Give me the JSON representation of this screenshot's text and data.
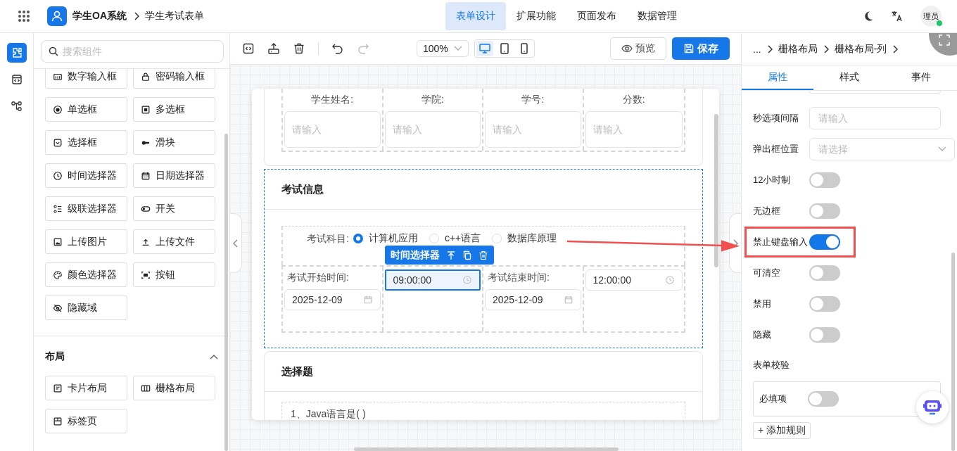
{
  "header": {
    "app_name": "学生OA系统",
    "breadcrumb": "学生考试表单",
    "avatar": "理员",
    "online": true
  },
  "nav_tabs": [
    {
      "label": "表单设计",
      "selected": true
    },
    {
      "label": "扩展功能",
      "selected": false
    },
    {
      "label": "页面发布",
      "selected": false
    },
    {
      "label": "数据管理",
      "selected": false
    }
  ],
  "rail": [
    {
      "kind": "components",
      "selected": true
    },
    {
      "kind": "code",
      "selected": false
    },
    {
      "kind": "tree",
      "selected": false
    }
  ],
  "component_panel": {
    "search": {
      "placeholder": "搜索组件"
    },
    "components": [
      {
        "label": "数字输入框",
        "kind": "number"
      },
      {
        "label": "密码输入框",
        "kind": "lock"
      },
      {
        "label": "单选框",
        "kind": "radio"
      },
      {
        "label": "多选框",
        "kind": "checkbox"
      },
      {
        "label": "选择框",
        "kind": "select"
      },
      {
        "label": "滑块",
        "kind": "slider"
      },
      {
        "label": "时间选择器",
        "kind": "clock"
      },
      {
        "label": "日期选择器",
        "kind": "calendar"
      },
      {
        "label": "级联选择器",
        "kind": "cascade"
      },
      {
        "label": "开关",
        "kind": "switch"
      },
      {
        "label": "上传图片",
        "kind": "image"
      },
      {
        "label": "上传文件",
        "kind": "upload"
      },
      {
        "label": "颜色选择器",
        "kind": "palette"
      },
      {
        "label": "按钮",
        "kind": "button"
      },
      {
        "label": "隐藏域",
        "kind": "hidden"
      }
    ],
    "layout_section": {
      "title": "布局",
      "expanded": true,
      "items": [
        {
          "label": "卡片布局",
          "kind": "card"
        },
        {
          "label": "栅格布局",
          "kind": "grid"
        },
        {
          "label": "标签页",
          "kind": "tabs"
        }
      ]
    }
  },
  "toolbar": {
    "zoom": "100%",
    "devices": [
      {
        "kind": "desktop",
        "selected": true
      },
      {
        "kind": "tablet",
        "selected": false
      },
      {
        "kind": "phone",
        "selected": false
      }
    ],
    "preview": "预览",
    "save": "保存"
  },
  "form": {
    "student_row": [
      {
        "label": "学生姓名:",
        "placeholder": "请输入"
      },
      {
        "label": "学院:",
        "placeholder": "请输入"
      },
      {
        "label": "学号:",
        "placeholder": "请输入"
      },
      {
        "label": "分数:",
        "placeholder": "请输入"
      }
    ],
    "exam_section": {
      "title": "考试信息",
      "selected": true,
      "subject": {
        "label": "考试科目:",
        "options": [
          {
            "label": "计算机应用",
            "selected": true
          },
          {
            "label": "c++语言",
            "selected": false
          },
          {
            "label": "数据库原理",
            "selected": false
          }
        ]
      },
      "selection_toolbar": "时间选择器",
      "start_label": "考试开始时间:",
      "start_date": "2025-12-09",
      "start_time": {
        "value": "09:00:00",
        "selected": true
      },
      "end_label": "考试结束时间:",
      "end_date": "2025-12-09",
      "end_time": {
        "value": "12:00:00",
        "selected": false
      }
    },
    "choice_section": {
      "title": "选择题",
      "question": "1、Java语言是( )"
    }
  },
  "props_panel": {
    "breadcrumb": [
      "...",
      "栅格布局",
      "栅格布局-列"
    ],
    "tabs": [
      {
        "label": "属性",
        "selected": true
      },
      {
        "label": "样式",
        "selected": false
      },
      {
        "label": "事件",
        "selected": false
      }
    ],
    "fields": [
      {
        "label": "秒选项间隔",
        "kind": "input",
        "placeholder": "请输入"
      },
      {
        "label": "弹出框位置",
        "kind": "select",
        "placeholder": "请选择"
      },
      {
        "label": "12小时制",
        "kind": "switch",
        "on": false,
        "highlighted": false
      },
      {
        "label": "无边框",
        "kind": "switch",
        "on": false,
        "highlighted": false
      },
      {
        "label": "禁止键盘输入",
        "kind": "switch",
        "on": true,
        "highlighted": true
      },
      {
        "label": "可清空",
        "kind": "switch",
        "on": false,
        "highlighted": false
      },
      {
        "label": "禁用",
        "kind": "switch",
        "on": false,
        "highlighted": false
      },
      {
        "label": "隐藏",
        "kind": "switch",
        "on": false,
        "highlighted": false
      }
    ],
    "validation": {
      "title": "表单校验",
      "rules": [
        {
          "label": "必填项",
          "on": false
        }
      ],
      "add_rule": "+ 添加规则"
    }
  }
}
